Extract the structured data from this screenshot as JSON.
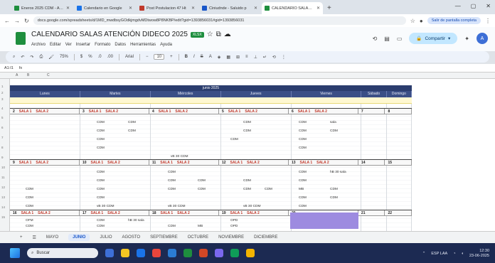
{
  "browser": {
    "tabs": [
      {
        "title": "Eneros 2025 CDM - Arqu",
        "color": "#1e8e3e",
        "active": false
      },
      {
        "title": "Calendario en Google",
        "color": "#1a73e8",
        "active": false
      },
      {
        "title": "Post Postulacion 47 Ht",
        "color": "#c0392b",
        "active": false
      },
      {
        "title": "Ciniudnde - Saluido p",
        "color": "#1a57c9",
        "active": false
      },
      {
        "title": "CALENDARIO SALAS ATEN",
        "color": "#1e8e3e",
        "active": true
      }
    ],
    "url": "docs.google.com/spreadsheets/d/1MD_mwdbsyGOdkjmgdvMDtwow8P8NKBP/edit?gid=1393856031#gid=1393856031",
    "exit_label": "Salir de pantalla completa"
  },
  "sheet": {
    "title": "CALENDARIO SALAS ATENCIÓN DIDECO 2025",
    "badge": "XLSX",
    "menu": [
      "Archivo",
      "Editar",
      "Ver",
      "Insertar",
      "Formato",
      "Datos",
      "Herramientas",
      "Ayuda"
    ],
    "share_label": "Compartir",
    "avatar_letter": "A",
    "zoom": "75%",
    "font": "Arial",
    "font_size": "10",
    "cell_ref": "A1:I1"
  },
  "grid": {
    "month_title": "junio 2025",
    "days": [
      "Lunes",
      "Martes",
      "Miércoles",
      "Jueves",
      "Viernes",
      "Sábado",
      "Domingo"
    ],
    "sala_label": "SALA 1",
    "sala_label2": "SALA 2",
    "weeks": [
      {
        "nums": [
          "2",
          "3",
          "4",
          "5",
          "6",
          "7",
          "8"
        ]
      },
      {
        "nums": [
          "9",
          "10",
          "11",
          "12",
          "13",
          "14",
          "15"
        ]
      },
      {
        "nums": [
          "16",
          "17",
          "18",
          "19",
          "20",
          "21",
          "22"
        ]
      }
    ],
    "entries": {
      "cdm": "CDM",
      "opd": "OPD",
      "sala": "sala",
      "ofm": "OFM",
      "vb": "vB 30 CDM",
      "mb": "MB",
      "hb": "hB 30 sala"
    }
  },
  "sheet_tabs": [
    "MAYO",
    "JUNIO",
    "JULIO",
    "AGOSTO",
    "SEPTIEMBRE",
    "OCTUBRE",
    "NOVIEMBRE",
    "DICIEMBRE"
  ],
  "taskbar": {
    "search_label": "Buscar",
    "lang": "ESP LAA",
    "time": "12:30",
    "date": "23-06-2025"
  }
}
